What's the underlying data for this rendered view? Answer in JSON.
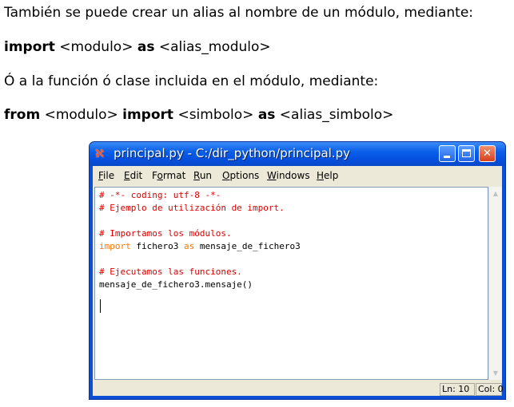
{
  "paragraphs": {
    "p1": "También se puede crear un alias al nombre de un módulo, mediante:",
    "p2": {
      "kw1": "import",
      "t1": " <modulo> ",
      "kw2": "as",
      "t2": " <alias_modulo>"
    },
    "p3": "Ó a la función ó clase incluida en el módulo, mediante:",
    "p4": {
      "kw1": "from",
      "t1": " <modulo> ",
      "kw2": "import",
      "t2": " <simbolo> ",
      "kw3": "as",
      "t3": " <alias_simbolo>"
    }
  },
  "window": {
    "icon": "python-idle-icon",
    "title": "principal.py - C:/dir_python/principal.py",
    "buttons": [
      "minimize",
      "maximize",
      "close"
    ],
    "close_glyph": "✕"
  },
  "menu": {
    "file": {
      "u": "F",
      "rest": "ile"
    },
    "edit": {
      "u": "E",
      "rest": "dit"
    },
    "format": {
      "pre": "F",
      "u": "o",
      "rest": "rmat"
    },
    "run": {
      "u": "R",
      "rest": "un"
    },
    "options": {
      "u": "O",
      "rest": "ptions"
    },
    "windows": {
      "u": "W",
      "rest": "indows"
    },
    "help": {
      "u": "H",
      "rest": "elp"
    }
  },
  "code": {
    "line1": "# -*- coding: utf-8 -*-",
    "line2": "# Ejemplo de utilización de import.",
    "line3": "# Importamos los módulos.",
    "line4_kw1": "import",
    "line4_mid": " fichero3 ",
    "line4_kw2": "as",
    "line4_rest": " mensaje_de_fichero3",
    "line5": "# Ejecutamos las funciones.",
    "line6": "mensaje_de_fichero3.mensaje()"
  },
  "status": {
    "ln": "Ln: 10",
    "col": "Col: 0"
  },
  "colors": {
    "comment": "#dd0000",
    "keyword": "#ff7700",
    "titlebar": "#0a5fe8"
  }
}
